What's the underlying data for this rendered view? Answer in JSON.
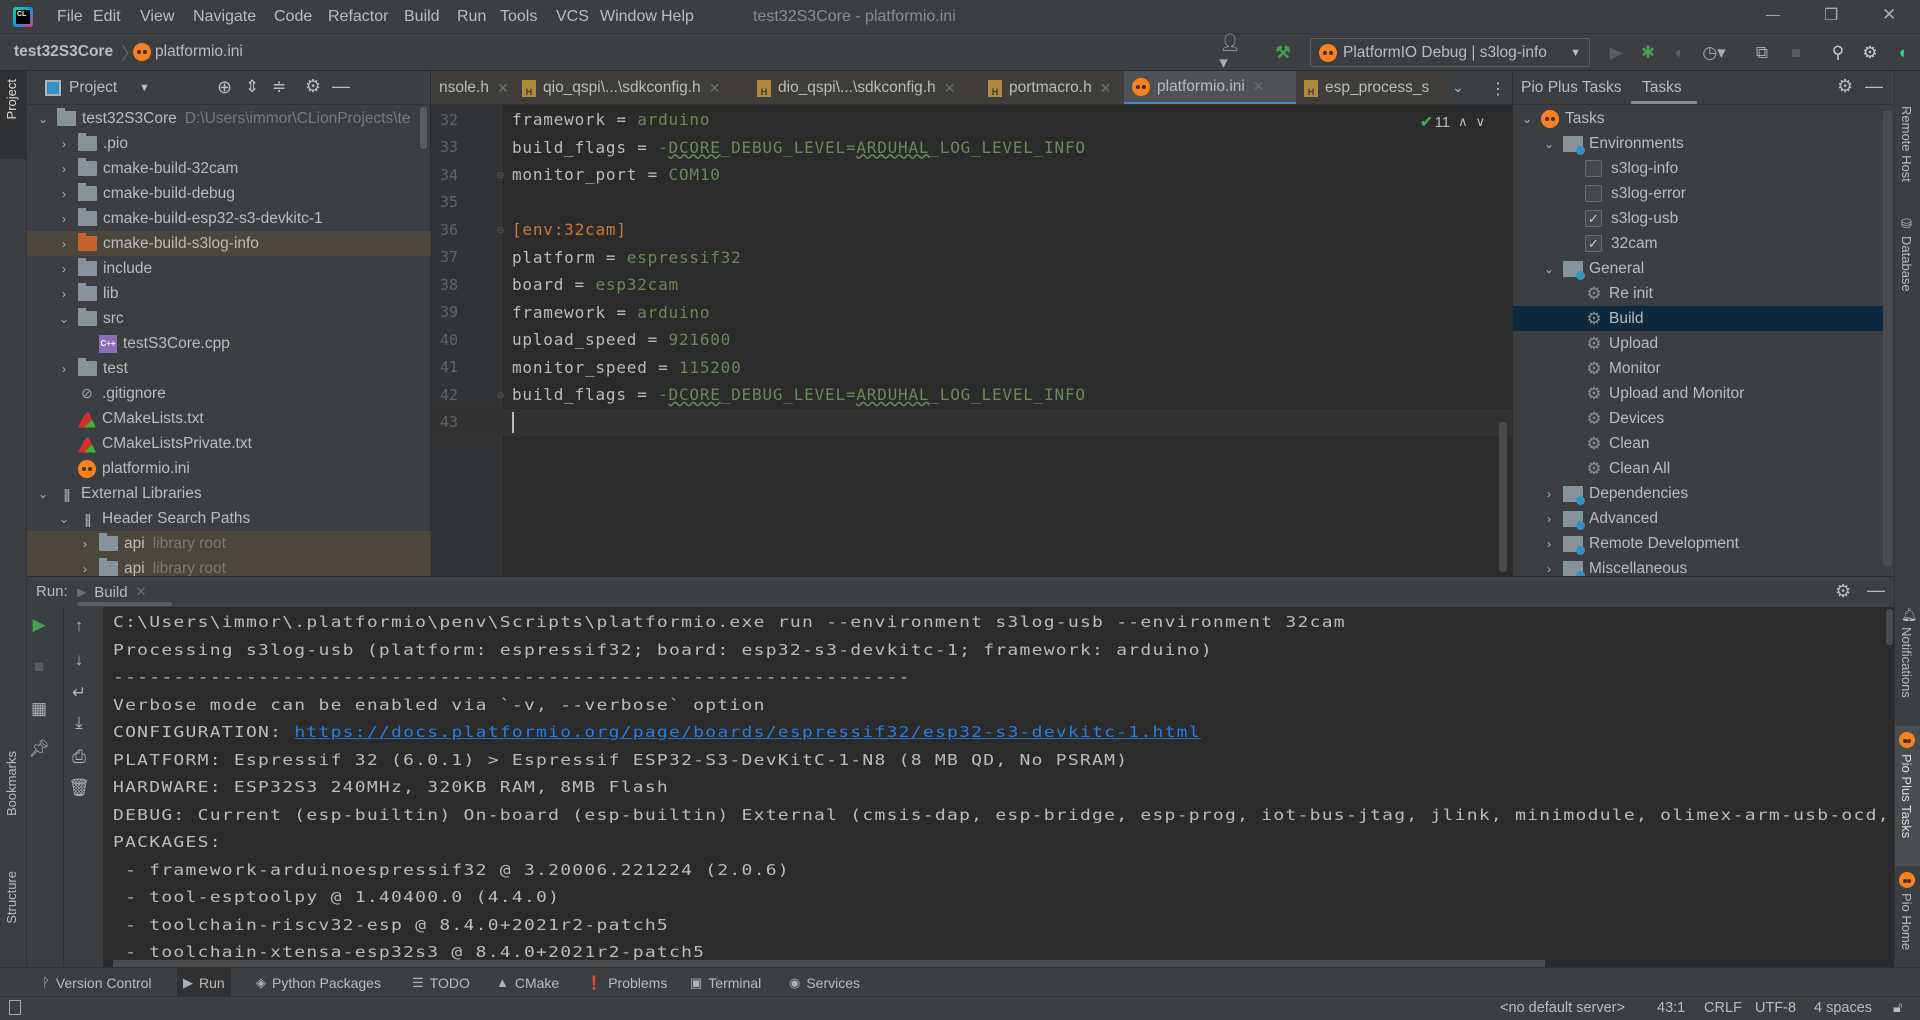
{
  "window": {
    "title": "test32S3Core - platformio.ini",
    "menu": [
      "File",
      "Edit",
      "View",
      "Navigate",
      "Code",
      "Refactor",
      "Build",
      "Run",
      "Tools",
      "VCS",
      "Window",
      "Help"
    ],
    "controls": {
      "minimize": "—",
      "restore": "❐",
      "close": "✕"
    }
  },
  "navbar": {
    "project": "test32S3Core",
    "file": "platformio.ini",
    "run_config": "PlatformIO Debug | s3log-info"
  },
  "left_stripe": {
    "project": "Project",
    "bookmarks": "Bookmarks",
    "structure": "Structure"
  },
  "right_stripe": {
    "remote_host": "Remote Host",
    "database": "Database",
    "notifications": "Notifications",
    "pio_plus_tasks": "Pio Plus Tasks",
    "pio_home": "Pio Home"
  },
  "project_panel": {
    "title": "Project",
    "tree": [
      {
        "label": "test32S3Core",
        "hint": "D:\\Users\\immor\\CLionProjects\\te",
        "depth": 0,
        "type": "folder",
        "arrow": "down"
      },
      {
        "label": ".pio",
        "depth": 1,
        "type": "folder",
        "arrow": "right"
      },
      {
        "label": "cmake-build-32cam",
        "depth": 1,
        "type": "folder",
        "arrow": "right"
      },
      {
        "label": "cmake-build-debug",
        "depth": 1,
        "type": "folder",
        "arrow": "right"
      },
      {
        "label": "cmake-build-esp32-s3-devkitc-1",
        "depth": 1,
        "type": "folder",
        "arrow": "right"
      },
      {
        "label": "cmake-build-s3log-info",
        "depth": 1,
        "type": "folder-orange",
        "arrow": "right",
        "selected": true
      },
      {
        "label": "include",
        "depth": 1,
        "type": "folder",
        "arrow": "right"
      },
      {
        "label": "lib",
        "depth": 1,
        "type": "folder",
        "arrow": "right"
      },
      {
        "label": "src",
        "depth": 1,
        "type": "folder",
        "arrow": "down"
      },
      {
        "label": "testS3Core.cpp",
        "depth": 2,
        "type": "cpp"
      },
      {
        "label": "test",
        "depth": 1,
        "type": "folder",
        "arrow": "right"
      },
      {
        "label": ".gitignore",
        "depth": 1,
        "type": "ignore"
      },
      {
        "label": "CMakeLists.txt",
        "depth": 1,
        "type": "cmake"
      },
      {
        "label": "CMakeListsPrivate.txt",
        "depth": 1,
        "type": "cmake"
      },
      {
        "label": "platformio.ini",
        "depth": 1,
        "type": "pio"
      },
      {
        "label": "External Libraries",
        "depth": 0,
        "type": "libs",
        "arrow": "down"
      },
      {
        "label": "Header Search Paths",
        "depth": 1,
        "type": "libs",
        "arrow": "down"
      },
      {
        "label": "api",
        "hint": "library root",
        "depth": 2,
        "type": "folder",
        "arrow": "right",
        "selected": true
      },
      {
        "label": "api",
        "hint": "library root",
        "depth": 2,
        "type": "folder",
        "arrow": "right",
        "selected": true
      }
    ]
  },
  "editor": {
    "tabs": [
      {
        "label": "nsole.h",
        "icon": "none"
      },
      {
        "label": "qio_qspi\\...\\sdkconfig.h",
        "icon": "header"
      },
      {
        "label": "dio_qspi\\...\\sdkconfig.h",
        "icon": "header"
      },
      {
        "label": "portmacro.h",
        "icon": "header"
      },
      {
        "label": "platformio.ini",
        "icon": "pio",
        "active": true
      },
      {
        "label": "esp_process_s",
        "icon": "header"
      }
    ],
    "inspection_count": "11",
    "lines": [
      {
        "n": "32",
        "key": "framework",
        "value": "arduino"
      },
      {
        "n": "33",
        "key": "build_flags",
        "value": "-DCORE_DEBUG_LEVEL=ARDUHAL_LOG_LEVEL_INFO",
        "wavy": [
          "DCORE",
          "ARDUHAL"
        ]
      },
      {
        "n": "34",
        "key": "monitor_port",
        "value": "COM10"
      },
      {
        "n": "35"
      },
      {
        "n": "36",
        "section": "[env:32cam]"
      },
      {
        "n": "37",
        "key": "platform",
        "value": "espressif32"
      },
      {
        "n": "38",
        "key": "board",
        "value": "esp32cam"
      },
      {
        "n": "39",
        "key": "framework",
        "value": "arduino"
      },
      {
        "n": "40",
        "key": "upload_speed",
        "value": "921600"
      },
      {
        "n": "41",
        "key": "monitor_speed",
        "value": "115200"
      },
      {
        "n": "42",
        "key": "build_flags",
        "value": "-DCORE_DEBUG_LEVEL=ARDUHAL_LOG_LEVEL_INFO",
        "wavy": [
          "DCORE",
          "ARDUHAL"
        ]
      },
      {
        "n": "43",
        "current": true
      }
    ]
  },
  "right_panel": {
    "tabs": [
      "Pio Plus Tasks",
      "Tasks"
    ],
    "active_tab": "Tasks",
    "tree": [
      {
        "label": "Tasks",
        "depth": 0,
        "type": "pio",
        "arrow": "down"
      },
      {
        "label": "Environments",
        "depth": 1,
        "type": "env",
        "arrow": "down"
      },
      {
        "label": "s3log-info",
        "depth": 2,
        "type": "checkbox",
        "checked": false
      },
      {
        "label": "s3log-error",
        "depth": 2,
        "type": "checkbox",
        "checked": false
      },
      {
        "label": "s3log-usb",
        "depth": 2,
        "type": "checkbox",
        "checked": true
      },
      {
        "label": "32cam",
        "depth": 2,
        "type": "checkbox",
        "checked": true
      },
      {
        "label": "General",
        "depth": 1,
        "type": "fgear",
        "arrow": "down"
      },
      {
        "label": "Re init",
        "depth": 2,
        "type": "gear"
      },
      {
        "label": "Build",
        "depth": 2,
        "type": "gear",
        "selected": true
      },
      {
        "label": "Upload",
        "depth": 2,
        "type": "gear"
      },
      {
        "label": "Monitor",
        "depth": 2,
        "type": "gear"
      },
      {
        "label": "Upload and Monitor",
        "depth": 2,
        "type": "gear"
      },
      {
        "label": "Devices",
        "depth": 2,
        "type": "gear"
      },
      {
        "label": "Clean",
        "depth": 2,
        "type": "gear"
      },
      {
        "label": "Clean All",
        "depth": 2,
        "type": "gear"
      },
      {
        "label": "Dependencies",
        "depth": 1,
        "type": "fgear",
        "arrow": "right"
      },
      {
        "label": "Advanced",
        "depth": 1,
        "type": "fgear",
        "arrow": "right"
      },
      {
        "label": "Remote Development",
        "depth": 1,
        "type": "fgear",
        "arrow": "right"
      },
      {
        "label": "Miscellaneous",
        "depth": 1,
        "type": "fgear",
        "arrow": "right"
      }
    ]
  },
  "run_panel": {
    "label": "Run:",
    "tab": "Build",
    "console": [
      {
        "text": "C:\\Users\\immor\\.platformio\\penv\\Scripts\\platformio.exe run --environment s3log-usb --environment 32cam"
      },
      {
        "text": "Processing s3log-usb (platform: espressif32; board: esp32-s3-devkitc-1; framework: arduino)"
      },
      {
        "text": "------------------------------------------------------------------"
      },
      {
        "text": "Verbose mode can be enabled via `-v, --verbose` option"
      },
      {
        "text": "CONFIGURATION: ",
        "link": "https://docs.platformio.org/page/boards/espressif32/esp32-s3-devkitc-1.html"
      },
      {
        "text": "PLATFORM: Espressif 32 (6.0.1) > Espressif ESP32-S3-DevKitC-1-N8 (8 MB QD, No PSRAM)"
      },
      {
        "text": "HARDWARE: ESP32S3 240MHz, 320KB RAM, 8MB Flash"
      },
      {
        "text": "DEBUG: Current (esp-builtin) On-board (esp-builtin) External (cmsis-dap, esp-bridge, esp-prog, iot-bus-jtag, jlink, minimodule, olimex-arm-usb-ocd, olimex-arm-usb-ocd-h, olimex-a"
      },
      {
        "text": "PACKAGES:"
      },
      {
        "text": " - framework-arduinoespressif32 @ 3.20006.221224 (2.0.6)"
      },
      {
        "text": " - tool-esptoolpy @ 1.40400.0 (4.4.0)"
      },
      {
        "text": " - toolchain-riscv32-esp @ 8.4.0+2021r2-patch5"
      },
      {
        "text": " - toolchain-xtensa-esp32s3 @ 8.4.0+2021r2-patch5"
      }
    ]
  },
  "bottom_tabs": [
    {
      "label": "Version Control",
      "icon": "ᚹ"
    },
    {
      "label": "Run",
      "icon": "▶",
      "active": true
    },
    {
      "label": "Python Packages",
      "icon": "◈"
    },
    {
      "label": "TODO",
      "icon": "☰"
    },
    {
      "label": "CMake",
      "icon": "▲"
    },
    {
      "label": "Problems",
      "icon": "❗"
    },
    {
      "label": "Terminal",
      "icon": "▣"
    },
    {
      "label": "Services",
      "icon": "◉"
    }
  ],
  "status": {
    "server": "<no default server>",
    "position": "43:1",
    "line_sep": "CRLF",
    "encoding": "UTF-8",
    "indent": "4 spaces"
  },
  "colors": {
    "accent": "#4a88c7",
    "pio_orange": "#f5821f",
    "value_green": "#6a8759",
    "section_orange": "#cc7832",
    "link": "#287bde",
    "selected_task": "#0d293e"
  }
}
